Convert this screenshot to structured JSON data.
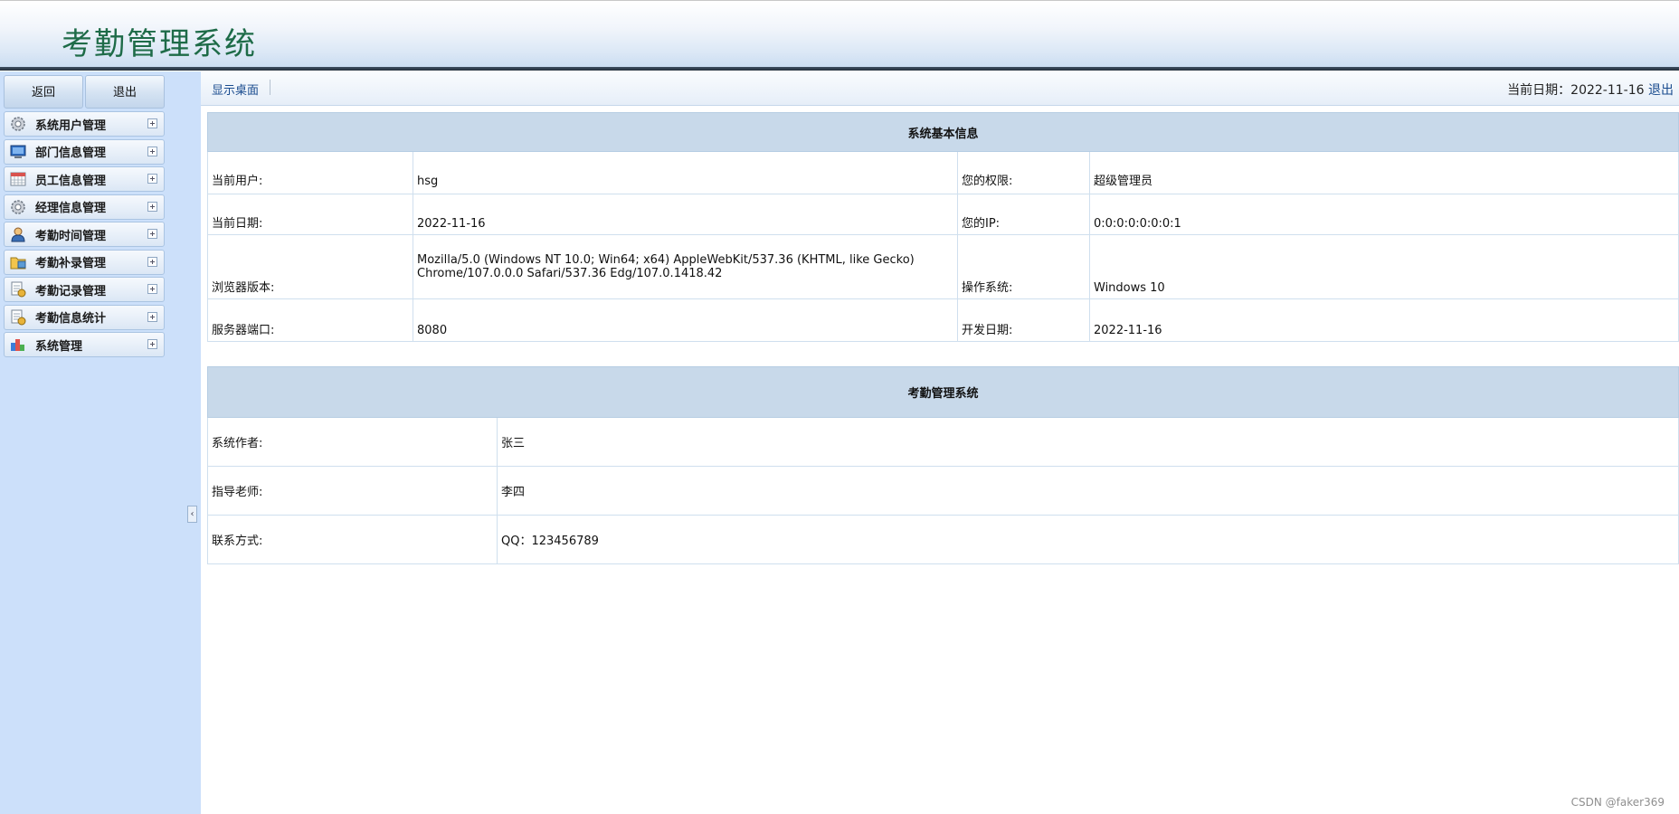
{
  "header": {
    "title": "考勤管理系统"
  },
  "sidebar": {
    "buttons": {
      "back": "返回",
      "logout": "退出"
    },
    "items": [
      {
        "label": "系统用户管理",
        "icon": "gear-icon"
      },
      {
        "label": "部门信息管理",
        "icon": "monitor-icon"
      },
      {
        "label": "员工信息管理",
        "icon": "calendar-icon"
      },
      {
        "label": "经理信息管理",
        "icon": "gear-icon"
      },
      {
        "label": "考勤时间管理",
        "icon": "person-icon"
      },
      {
        "label": "考勤补录管理",
        "icon": "folder-icon"
      },
      {
        "label": "考勤记录管理",
        "icon": "document-coin-icon"
      },
      {
        "label": "考勤信息统计",
        "icon": "document-coin-icon"
      },
      {
        "label": "系统管理",
        "icon": "blocks-icon"
      }
    ]
  },
  "topbar": {
    "show_desktop": "显示桌面",
    "date_label": "当前日期：",
    "date_value": "2022-11-16",
    "logout": "退出"
  },
  "system_info": {
    "title": "系统基本信息",
    "rows": [
      {
        "k1": "当前用户:",
        "v1": "hsg",
        "k2": "您的权限:",
        "v2": "超级管理员"
      },
      {
        "k1": "当前日期:",
        "v1": "2022-11-16",
        "k2": "您的IP:",
        "v2": "0:0:0:0:0:0:0:1"
      },
      {
        "k1": "浏览器版本:",
        "v1a": "Mozilla/5.0 (Windows NT 10.0; Win64; x64) AppleWebKit/537.36 (KHTML, like Gecko)",
        "v1b": "Chrome/107.0.0.0 Safari/537.36 Edg/107.0.1418.42",
        "k2": "操作系统:",
        "v2": "Windows 10"
      },
      {
        "k1": "服务器端口:",
        "v1": "8080",
        "k2": "开发日期:",
        "v2": "2022-11-16"
      }
    ]
  },
  "about": {
    "title": "考勤管理系统",
    "rows": [
      {
        "k": "系统作者:",
        "v": "张三"
      },
      {
        "k": "指导老师:",
        "v": "李四"
      },
      {
        "k": "联系方式:",
        "v": "QQ：123456789"
      }
    ]
  },
  "watermark": "CSDN @faker369",
  "colors": {
    "header_title": "#1e6b48",
    "sidebar_bg": "#cce0fa",
    "table_header_bg": "#c8d9ea",
    "link": "#1a4c8f"
  }
}
